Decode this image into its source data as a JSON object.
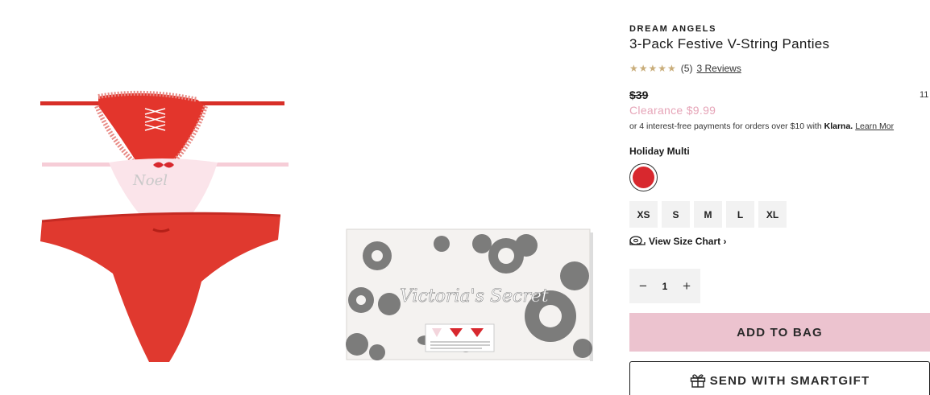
{
  "product": {
    "brand": "DREAM ANGELS",
    "title": "3-Pack Festive V-String Panties",
    "rating_stars": "★★★★★",
    "rating_count": "(5)",
    "reviews_link": "3 Reviews",
    "price_original": "$39",
    "price_side_number": "11",
    "price_sale": "Clearance $9.99",
    "klarna_text": "or 4 interest-free payments for orders over $10 with ",
    "klarna_brand": "Klarna.",
    "klarna_learn": "Learn Mor",
    "color_name": "Holiday Multi",
    "swatch_color": "#d8282e"
  },
  "sizes": [
    "XS",
    "S",
    "M",
    "L",
    "XL"
  ],
  "size_chart_label": "View Size Chart ›",
  "quantity": {
    "minus": "−",
    "value": "1",
    "plus": "+"
  },
  "buttons": {
    "add_to_bag": "ADD TO BAG",
    "smartgift": "SEND WITH SMARTGIFT"
  },
  "gallery": {
    "box_logo_text": "Victoria's Secret"
  },
  "colors": {
    "sale_pink": "#e6a5b8",
    "add_bag_pink": "#ecc3cf",
    "panty_red": "#e0392f",
    "panty_pink": "#f8dde4"
  }
}
